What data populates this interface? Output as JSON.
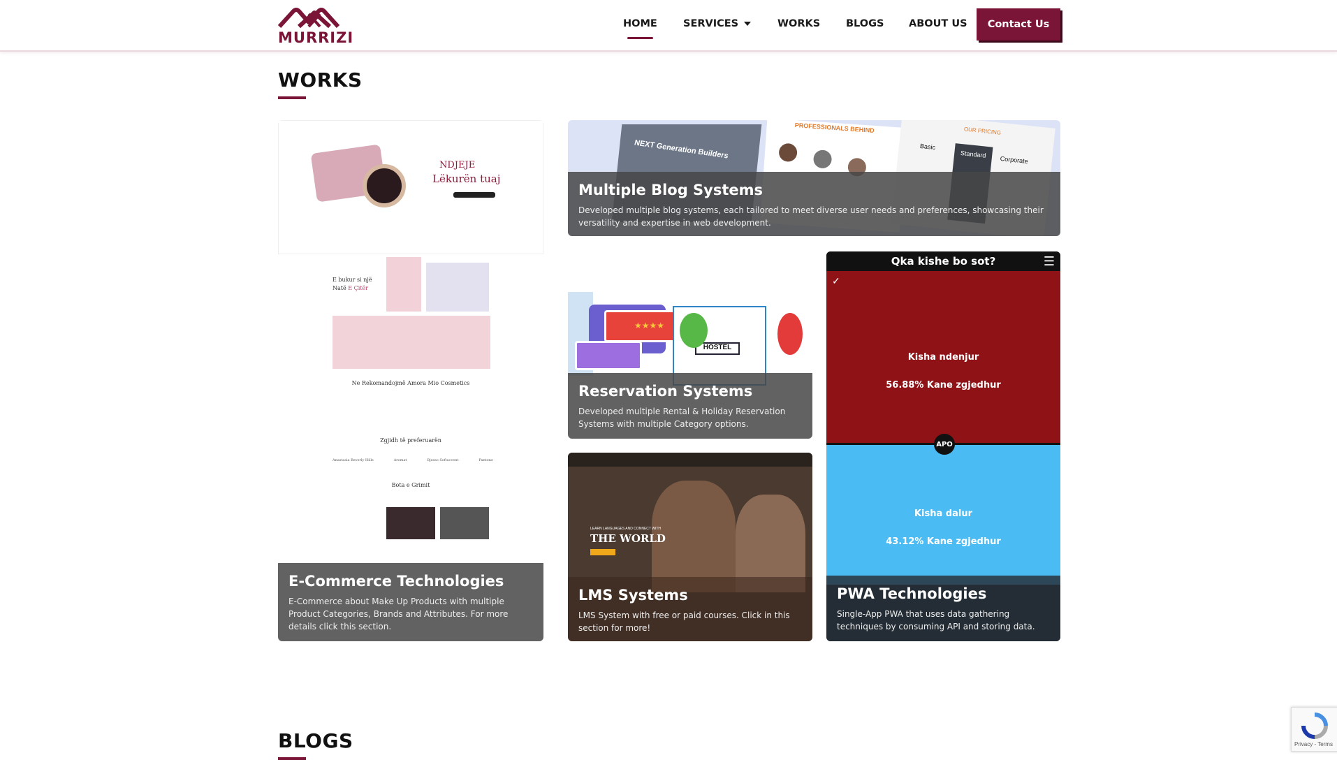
{
  "header": {
    "logo_text": "MURRIZI",
    "nav": [
      {
        "label": "HOME"
      },
      {
        "label": "SERVICES"
      },
      {
        "label": "WORKS"
      },
      {
        "label": "BLOGS"
      },
      {
        "label": "ABOUT US"
      }
    ],
    "contact_label": "Contact Us"
  },
  "works": {
    "title": "WORKS",
    "cards": [
      {
        "title": "Multiple Blog Systems",
        "desc": "Developed multiple blog systems, each tailored to meet diverse user needs and preferences, showcasing their versatility and expertise in web development."
      },
      {
        "title": "Reservation Systems",
        "desc": "Developed multiple Rental & Holiday Reservation Systems with multiple Category options."
      },
      {
        "title": "E-Commerce Technologies",
        "desc": "E-Commerce about Make Up Products with multiple Product Categories, Brands and Attributes. For more details click this section."
      },
      {
        "title": "LMS Systems",
        "desc": "LMS System with free or paid courses. Click in this section for more!"
      },
      {
        "title": "PWA Technologies",
        "desc": "Single-App PWA that uses data gathering techniques by consuming API and storing data."
      }
    ],
    "ecom_preview": {
      "hero_small": "NDJEJE",
      "hero_big": "Lëkurën tuaj",
      "promo_line1": "E bukur si një",
      "promo_line2": "Natë",
      "promo_line2_accent": "E Çitër",
      "recommend": "Ne Rekomandojmë Amora Mio Cosmetics",
      "choose": "Zgjidh të preferuarën",
      "world": "Bota e Grimit",
      "brands": [
        "Anastasia Beverly Hills",
        "Aromat",
        "Bjesso Softaccent",
        "Pantene"
      ]
    },
    "lms_preview": {
      "tagline": "LEARN LANGUAGES AND CONNECT WITH",
      "headline": "THE WORLD"
    },
    "reservation_preview": {
      "sign": "HOSTEL"
    },
    "blog_preview": {
      "banner": "NEXT Generation Builders",
      "team_title": "PROFESSIONALS BEHIND",
      "pricing_title": "OUR PRICING",
      "plans": [
        "Basic",
        "Standard",
        "Corporate"
      ]
    },
    "pwa": {
      "bar_title": "Qka kishe bo sot?",
      "menu_icon": "menu-icon",
      "opt1": "Kisha ndenjur",
      "opt1_pct": "56.88% Kane zgjedhur",
      "vs": "APO",
      "opt2": "Kisha dalur",
      "opt2_pct": "43.12% Kane zgjedhur",
      "red": "#8e1216",
      "blue": "#4bbcf3"
    }
  },
  "blogs": {
    "title": "BLOGS"
  },
  "recaptcha": {
    "links": "Privacy - Terms"
  },
  "colors": {
    "brand": "#7b1537"
  }
}
